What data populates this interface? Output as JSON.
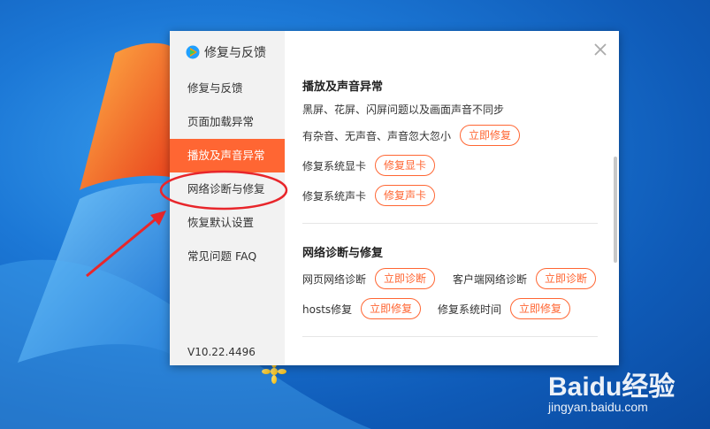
{
  "dialog": {
    "brand_title": "修复与反馈",
    "nav_items": [
      {
        "label": "修复与反馈",
        "active": false
      },
      {
        "label": "页面加载异常",
        "active": false
      },
      {
        "label": "播放及声音异常",
        "active": true
      },
      {
        "label": "网络诊断与修复",
        "active": false
      },
      {
        "label": "恢复默认设置",
        "active": false
      },
      {
        "label": "常见问题 FAQ",
        "active": false
      }
    ],
    "version": "V10.22.4496",
    "close_icon": "close-icon"
  },
  "playback_section": {
    "title": "播放及声音异常",
    "description": "黑屏、花屏、闪屏问题以及画面声音不同步",
    "noise_text": "有杂音、无声音、声音忽大忽小",
    "noise_button": "立即修复",
    "gpu_text": "修复系统显卡",
    "gpu_button": "修复显卡",
    "sound_text": "修复系统声卡",
    "sound_button": "修复声卡"
  },
  "network_section": {
    "title": "网络诊断与修复",
    "web_text": "网页网络诊断",
    "web_button": "立即诊断",
    "client_text": "客户端网络诊断",
    "client_button": "立即诊断",
    "hosts_text": "hosts修复",
    "hosts_button": "立即修复",
    "time_text": "修复系统时间",
    "time_button": "立即修复"
  },
  "watermark": {
    "main": "Baidu经验",
    "sub": "jingyan.baidu.com"
  },
  "colors": {
    "accent": "#ff6633",
    "annotation": "#e8262b",
    "desktop": "#1c78d6"
  }
}
